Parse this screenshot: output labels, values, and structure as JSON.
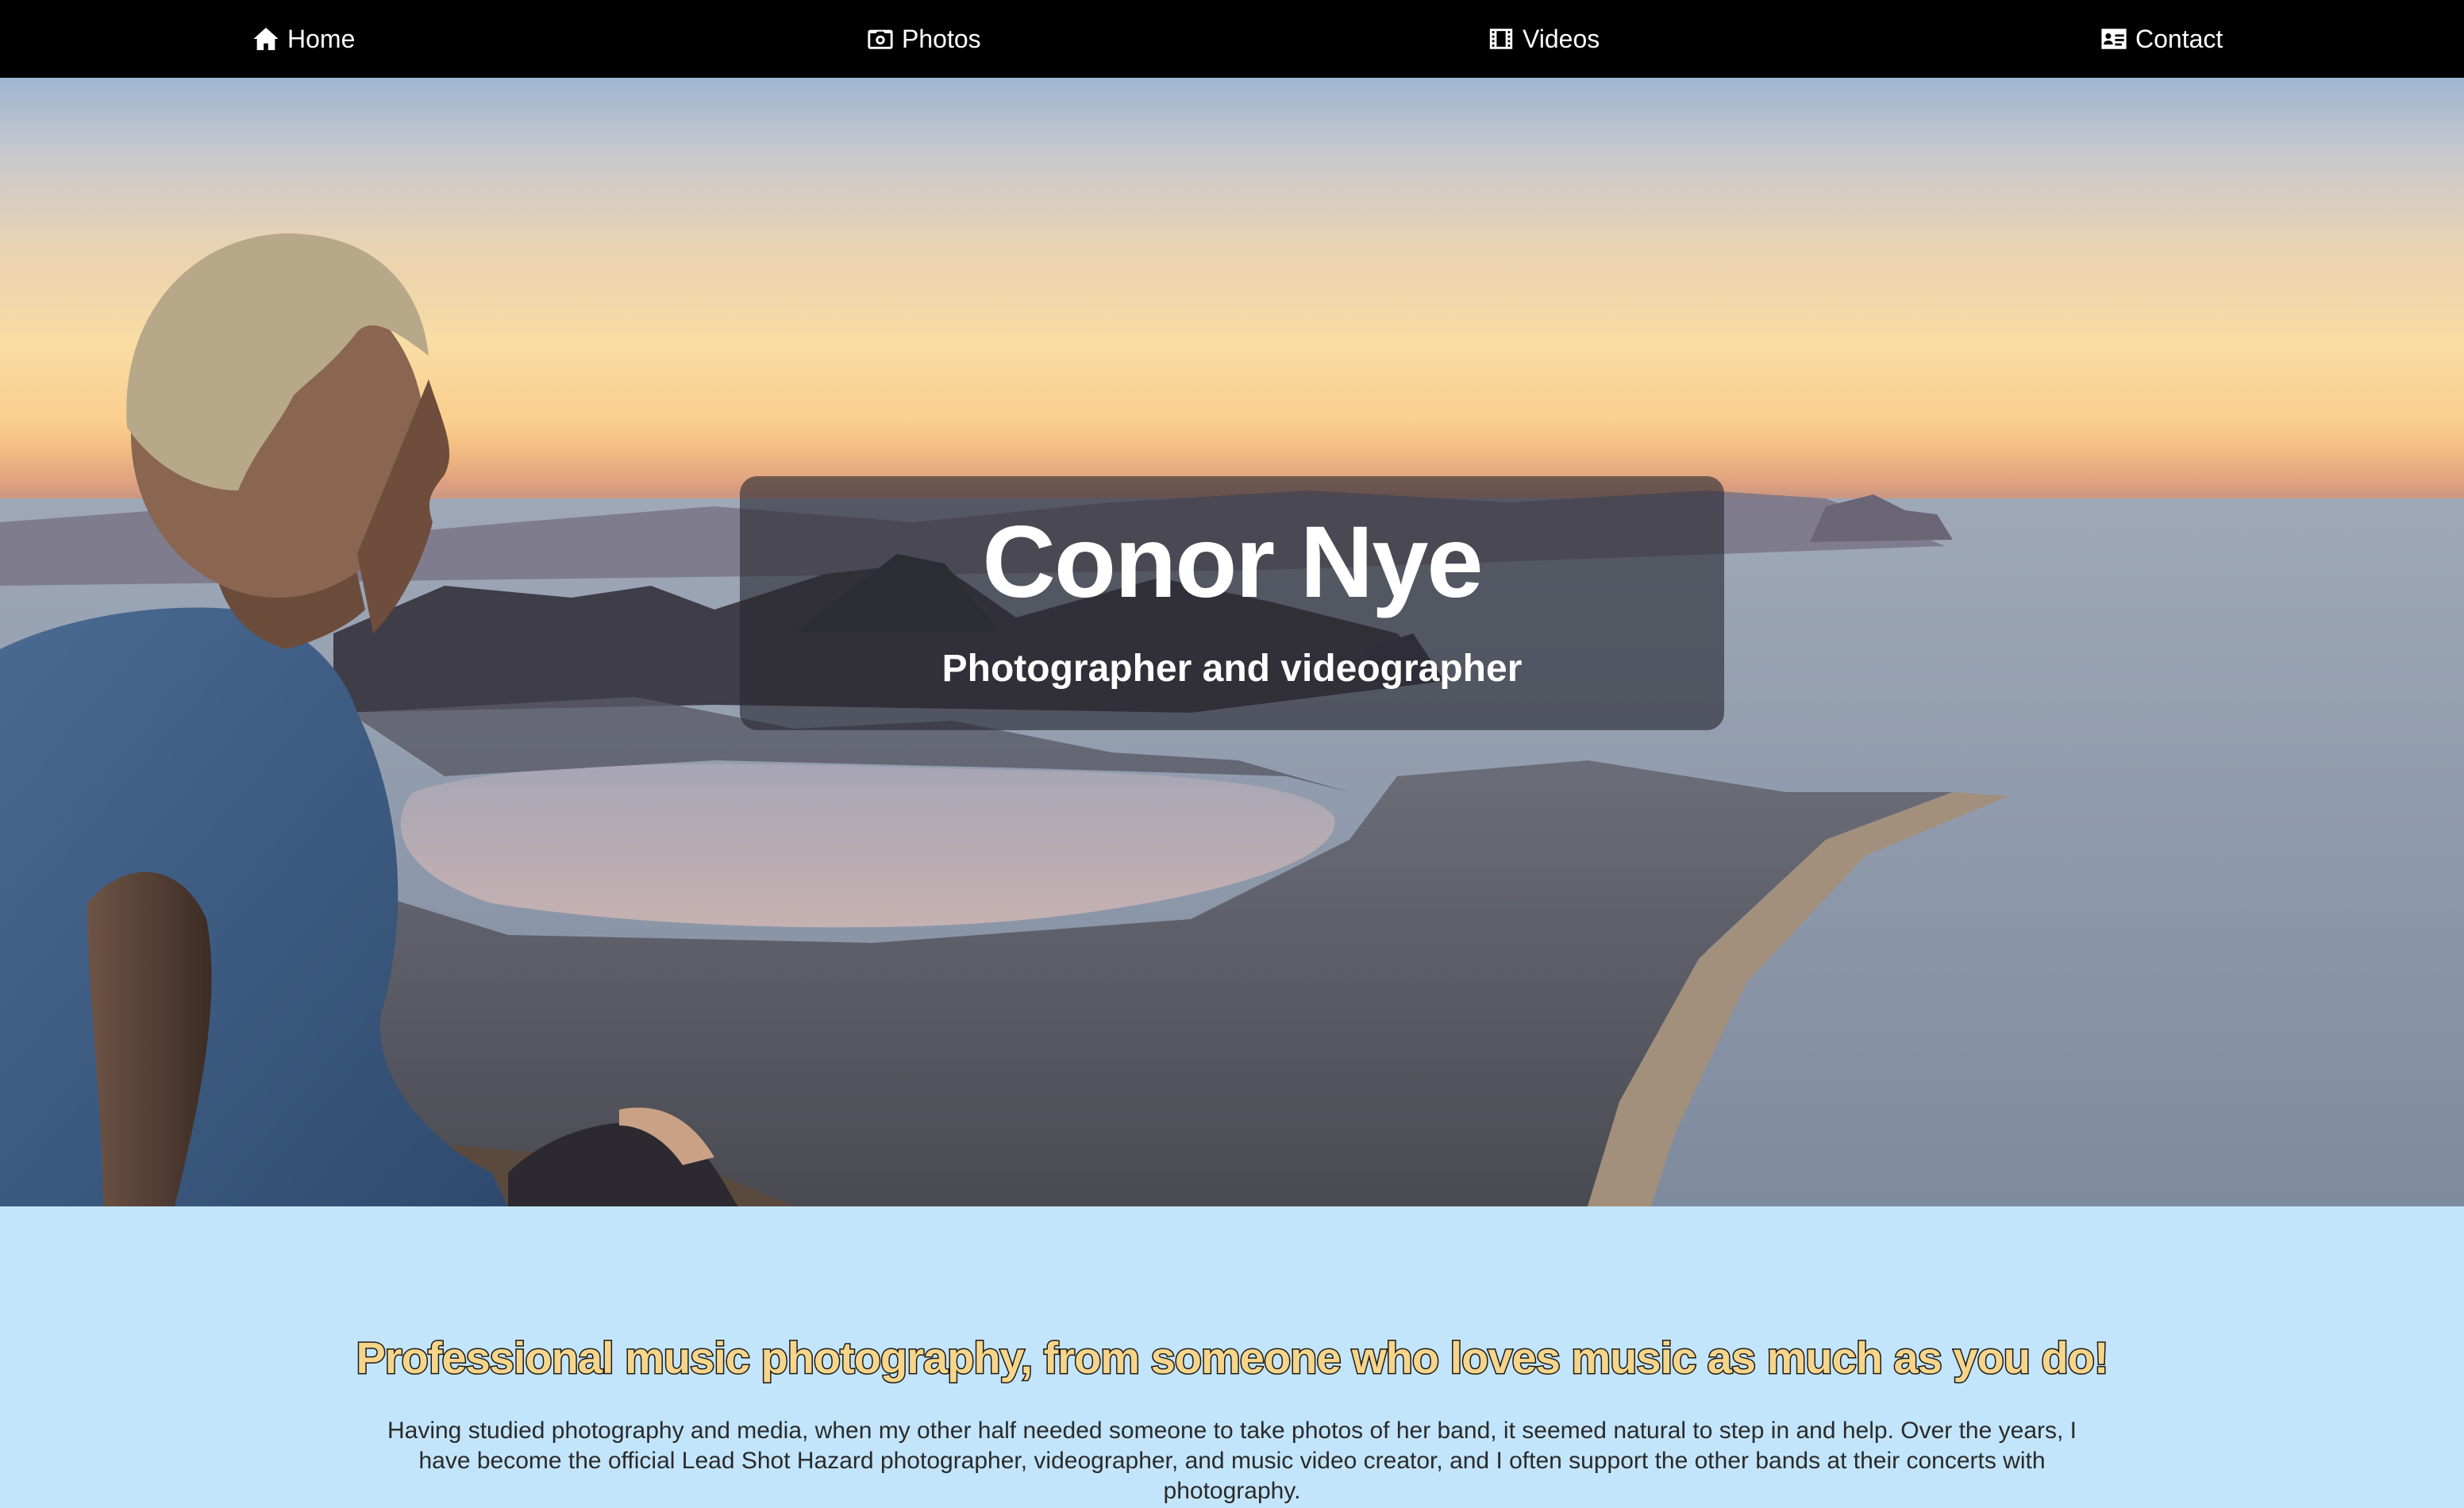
{
  "nav": {
    "items": [
      {
        "label": "Home",
        "icon": "home-icon"
      },
      {
        "label": "Photos",
        "icon": "camera-icon"
      },
      {
        "label": "Videos",
        "icon": "film-icon"
      },
      {
        "label": "Contact",
        "icon": "contact-card-icon"
      }
    ]
  },
  "hero": {
    "title": "Conor Nye",
    "subtitle": "Photographer and videographer"
  },
  "content": {
    "tagline": "Professional music photography, from someone who loves music as much as you do!",
    "intro": "Having studied photography and media, when my other half needed someone to take photos of her band, it seemed natural to step in and help. Over the years, I have become the official Lead Shot Hazard photographer, videographer, and music video creator, and I often support the other bands at their concerts with photography."
  },
  "colors": {
    "nav_background": "#000000",
    "content_background": "#c3e5fb",
    "tagline_fill": "#f6d58a",
    "tagline_outline": "#1a1a1a"
  }
}
